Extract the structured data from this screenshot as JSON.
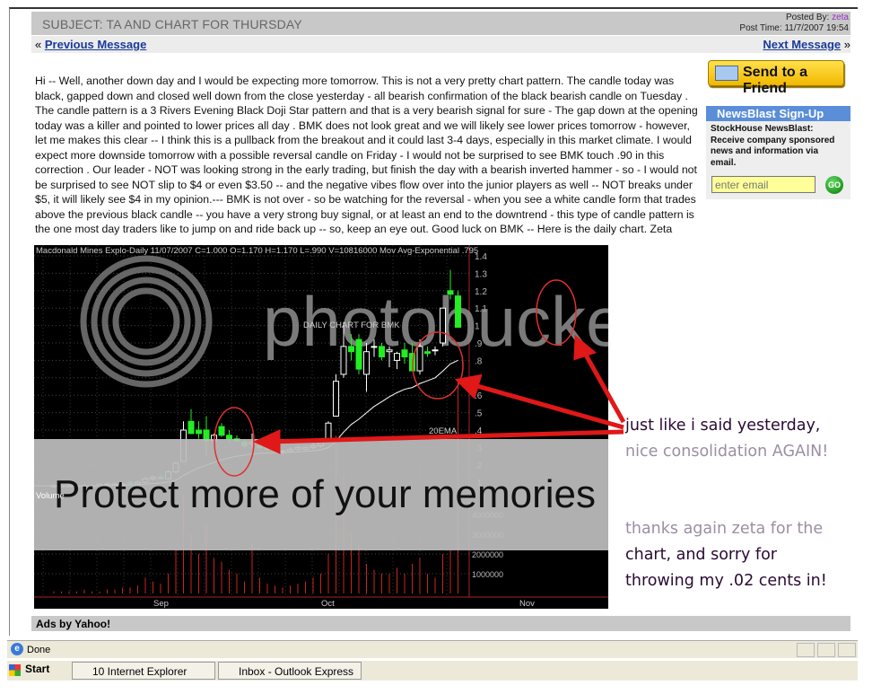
{
  "post": {
    "subject": "SUBJECT: TA AND CHART FOR THURSDAY",
    "posted_by_label": "Posted By:",
    "posted_by": "zeta",
    "post_time_label": "Post Time:",
    "post_time": "11/7/2007 19:54"
  },
  "nav": {
    "prev": "Previous Message",
    "next": "Next Message",
    "prev_arrow": "«",
    "next_arrow": "»"
  },
  "body": "Hi -- Well, another down day and I would be expecting more tomorrow. This is not a very pretty chart pattern. The candle today was black, gapped down and closed well down from the close yesterday - all bearish confirmation of the black bearish candle on Tuesday . The candle pattern is a 3 Rivers Evening Black Doji Star pattern and that is a very bearish signal for sure - The gap down at the opening today was a killer and pointed to lower prices all day . BMK does not look great and we will likely see lower prices tomorrow - however, let me makes this clear -- I think this is a pullback from the breakout and it could last 3-4 days, especially in this market climate. I would expect more downside tomorrow with a possible reversal candle on Friday - I would not be surprised to see BMK touch .90 in this correction . Our leader - NOT was looking strong in the early trading, but finish the day with a bearish inverted hammer - so - I would not be surprised to see NOT slip to $4 or even $3.50 -- and the negative vibes flow over into the junior players as well -- NOT breaks under $5, it will likely see $4 in my opinion.--- BMK is not over - so be watching for the reversal - when you see a white candle form that trades above the previous black candle -- you have a very strong buy signal, or at least an end to the downtrend - this type of candle pattern is the one most day traders like to jump on and ride back up -- so, keep an eye out. Good luck on BMK -- Here is the daily chart. Zeta",
  "sidebar": {
    "send_friend": "Send to a Friend",
    "send_icon": "envelope-icon",
    "newsblast_title": "NewsBlast Sign-Up",
    "newsblast_desc": "StockHouse NewsBlast: Receive company sponsored news and information via email.",
    "email_placeholder": "enter email",
    "go": "GO"
  },
  "chart_data": {
    "type": "candlestick",
    "header": "Macdonald Mines Explo-Daily   11/07/2007  C=1.000        O=1.170  H=1.170  L=.990  V=10816000  Mov Avg-Exponential      .795",
    "inner_label": "DAILY CHART FOR BMK",
    "ema_label": "20EMA",
    "volume_label": "Volume",
    "price_ticks": [
      "1.4",
      "1.3",
      "1.2",
      "1.1",
      "1",
      ".9",
      ".8",
      ".7",
      ".6",
      ".5",
      ".4",
      ".3",
      ".2",
      ".1"
    ],
    "price_tick_values": [
      1.4,
      1.3,
      1.2,
      1.1,
      1.0,
      0.9,
      0.8,
      0.7,
      0.6,
      0.5,
      0.4,
      0.3,
      0.2,
      0.1
    ],
    "volume_ticks": [
      "4000000",
      "3000000",
      "2000000",
      "1000000"
    ],
    "volume_tick_values": [
      4000000,
      3000000,
      2000000,
      1000000
    ],
    "x_labels": [
      "Sep",
      "Oct",
      "Nov"
    ],
    "x_label_index": [
      14,
      36,
      62
    ],
    "bull_color": "#ffffff",
    "bear_color": "#22ee22",
    "volume_color": "#cc2222",
    "ema_color": "#ffffff",
    "ohlc": [
      [
        0.08,
        0.09,
        0.07,
        0.08
      ],
      [
        0.08,
        0.09,
        0.07,
        0.08
      ],
      [
        0.08,
        0.09,
        0.08,
        0.08
      ],
      [
        0.08,
        0.09,
        0.07,
        0.08
      ],
      [
        0.08,
        0.09,
        0.08,
        0.08
      ],
      [
        0.08,
        0.09,
        0.07,
        0.08
      ],
      [
        0.08,
        0.09,
        0.08,
        0.09
      ],
      [
        0.09,
        0.1,
        0.08,
        0.09
      ],
      [
        0.09,
        0.1,
        0.08,
        0.09
      ],
      [
        0.09,
        0.1,
        0.08,
        0.09
      ],
      [
        0.1,
        0.11,
        0.09,
        0.09
      ],
      [
        0.09,
        0.11,
        0.09,
        0.1
      ],
      [
        0.1,
        0.13,
        0.09,
        0.12
      ],
      [
        0.12,
        0.14,
        0.11,
        0.13
      ],
      [
        0.13,
        0.15,
        0.12,
        0.12
      ],
      [
        0.12,
        0.17,
        0.12,
        0.16
      ],
      [
        0.16,
        0.22,
        0.15,
        0.21
      ],
      [
        0.22,
        0.45,
        0.22,
        0.4
      ],
      [
        0.45,
        0.52,
        0.38,
        0.38
      ],
      [
        0.4,
        0.45,
        0.35,
        0.38
      ],
      [
        0.4,
        0.48,
        0.25,
        0.34
      ],
      [
        0.34,
        0.38,
        0.3,
        0.37
      ],
      [
        0.42,
        0.44,
        0.36,
        0.37
      ],
      [
        0.37,
        0.4,
        0.33,
        0.35
      ],
      [
        0.35,
        0.37,
        0.33,
        0.34
      ],
      [
        0.33,
        0.34,
        0.3,
        0.31
      ],
      [
        0.32,
        0.38,
        0.3,
        0.33
      ],
      [
        0.31,
        0.32,
        0.29,
        0.3
      ],
      [
        0.3,
        0.31,
        0.28,
        0.29
      ],
      [
        0.29,
        0.3,
        0.27,
        0.28
      ],
      [
        0.28,
        0.29,
        0.26,
        0.28
      ],
      [
        0.28,
        0.3,
        0.27,
        0.29
      ],
      [
        0.29,
        0.31,
        0.28,
        0.3
      ],
      [
        0.29,
        0.31,
        0.28,
        0.3
      ],
      [
        0.3,
        0.33,
        0.29,
        0.31
      ],
      [
        0.31,
        0.34,
        0.3,
        0.33
      ],
      [
        0.33,
        0.45,
        0.33,
        0.44
      ],
      [
        0.48,
        0.72,
        0.5,
        0.68
      ],
      [
        0.72,
        1.02,
        0.7,
        0.88
      ],
      [
        0.88,
        0.95,
        0.8,
        0.85
      ],
      [
        0.92,
        0.95,
        0.72,
        0.75
      ],
      [
        0.72,
        0.9,
        0.62,
        0.85
      ],
      [
        0.88,
        0.92,
        0.82,
        0.88
      ],
      [
        0.88,
        0.9,
        0.8,
        0.82
      ],
      [
        0.85,
        0.88,
        0.76,
        0.86
      ],
      [
        0.8,
        0.85,
        0.75,
        0.84
      ],
      [
        0.86,
        0.9,
        0.78,
        0.82
      ],
      [
        0.84,
        0.9,
        0.74,
        0.74
      ],
      [
        0.74,
        0.92,
        0.72,
        0.88
      ],
      [
        0.85,
        0.88,
        0.82,
        0.84
      ],
      [
        0.86,
        0.88,
        0.83,
        0.86
      ],
      [
        0.9,
        1.1,
        0.88,
        1.1
      ],
      [
        1.2,
        1.32,
        1.15,
        1.18
      ],
      [
        1.17,
        1.2,
        0.99,
        0.99
      ]
    ],
    "volume": [
      0.1,
      0.1,
      0.1,
      0.1,
      0.2,
      0.1,
      0.1,
      0.2,
      0.2,
      0.3,
      0.3,
      0.4,
      0.8,
      0.6,
      0.5,
      1.0,
      2.2,
      5.0,
      3.0,
      2.0,
      3.5,
      1.8,
      1.6,
      1.2,
      1.0,
      0.6,
      2.5,
      0.8,
      0.5,
      0.4,
      0.3,
      0.4,
      0.5,
      0.6,
      0.8,
      1.0,
      2.0,
      8.0,
      6.0,
      3.0,
      2.5,
      1.5,
      1.2,
      1.0,
      1.0,
      1.3,
      1.0,
      1.5,
      1.8,
      1.0,
      0.8,
      2.0,
      2.2,
      10.8
    ]
  },
  "watermark": {
    "brand": "photobucket",
    "banner": "Protect more of your memories"
  },
  "annotations": [
    "just like i said yesterday,",
    "nice consolidation AGAIN!",
    "thanks again zeta for the",
    "chart, and sorry for",
    "throwing my .02 cents in!"
  ],
  "annotation_colors": {
    "dark": "#2a0a33",
    "light": "#9c8ea3",
    "arrow": "#e01818"
  },
  "ads": "Ads by Yahoo!",
  "status": {
    "text": "Done"
  },
  "taskbar": {
    "start": "Start",
    "items": [
      "10 Internet Explorer",
      "Inbox - Outlook Express"
    ]
  }
}
